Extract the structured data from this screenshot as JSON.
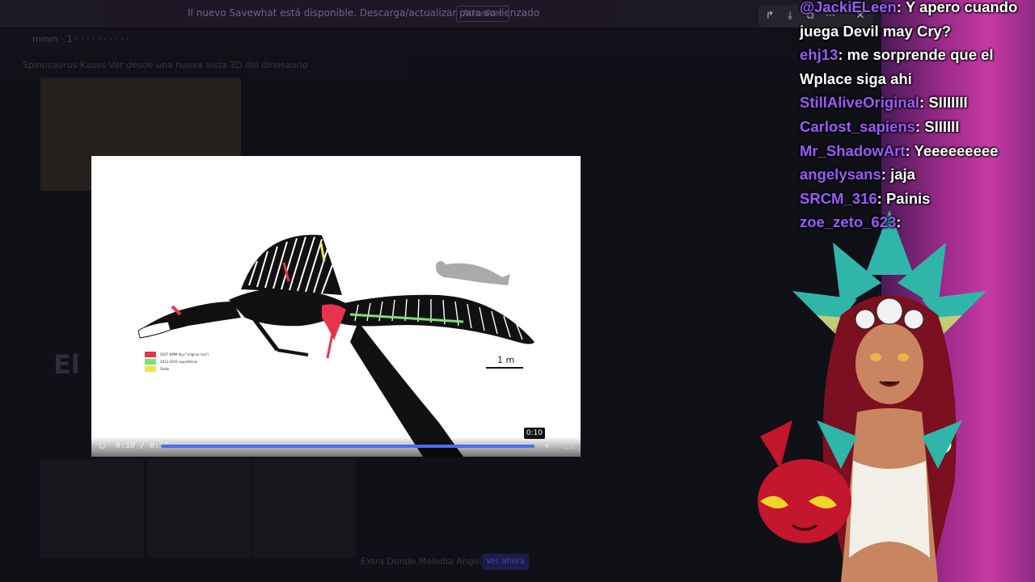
{
  "background_page": {
    "notice": "Il nuevo Savewhat está disponible. Descarga/actualizar para su lienzado",
    "notice_button": "Actualizar",
    "url_text": "mmm · 1 · · · · · · · · · ·",
    "sub_text": "Spinosaurus Kauss Ver desde una nueva vista 3D del dinosaurio",
    "big_title": "El n",
    "bottom_text": "Extra Donde Melodia Angeia",
    "bottom_button": "Ver ahora"
  },
  "viewer_tools": {
    "share": "share-icon",
    "download": "download-icon",
    "expand": "expand-icon",
    "more": "more-icon",
    "close": "close-icon"
  },
  "video": {
    "scale_label": "1 m",
    "legend": [
      {
        "label": "2007 NMM dig (\"original neo\")",
        "color": "#e8334a"
      },
      {
        "label": "2013-2019 expeditions",
        "color": "#7fe07a"
      },
      {
        "label": "Stelle",
        "color": "#f3e34a"
      }
    ],
    "time": "0:10 / 0:10",
    "tooltip": "0:10",
    "progress": 1.0
  },
  "chat": [
    {
      "user": "@JackiELeen",
      "text": ": Y apero cuando juega Devil may Cry?"
    },
    {
      "user": "ehj13",
      "text": ": me sorprende que el Wplace siga ahi"
    },
    {
      "user": "StillAliveOriginal",
      "text": ": SIIIIIII"
    },
    {
      "user": "Carlost_sapiens",
      "text": ": SIIIIII"
    },
    {
      "user": "Mr_ShadowArt",
      "text": ": Yeeeeeeeee"
    },
    {
      "user": "angelysans",
      "text": ": jaja"
    },
    {
      "user": "SRCM_316",
      "text": ": Painis"
    },
    {
      "user": "zoe_zeto_623",
      "text": ": "
    }
  ],
  "colors": {
    "accent": "#4a6df0",
    "chat_user": "#9b5cff",
    "stream_bg": "#c63aa3"
  }
}
